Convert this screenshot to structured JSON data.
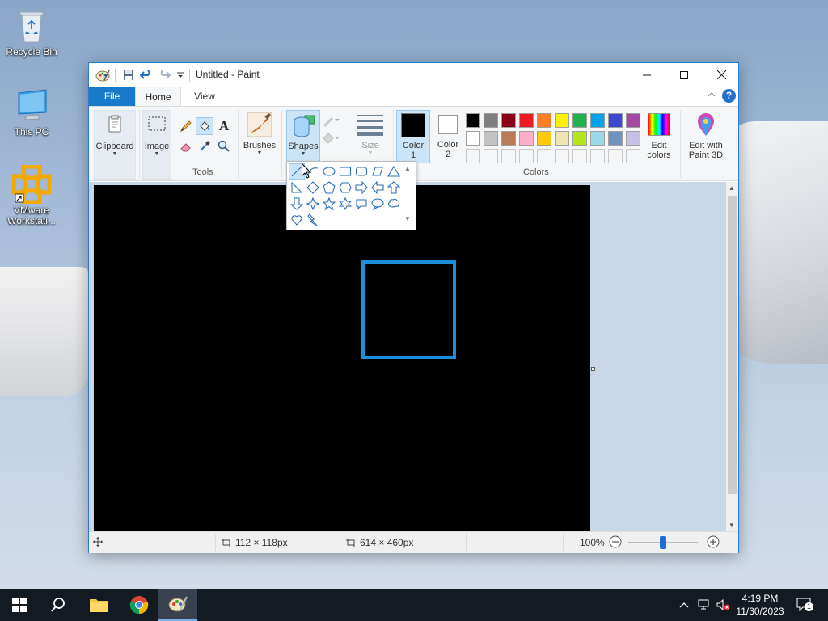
{
  "desktop": {
    "icons": [
      {
        "label": "Recycle Bin"
      },
      {
        "label": "This PC"
      },
      {
        "label": "VMware Workstati..."
      }
    ]
  },
  "window": {
    "title": "Untitled - Paint",
    "tabs": [
      {
        "label": "File"
      },
      {
        "label": "Home"
      },
      {
        "label": "View"
      }
    ]
  },
  "ribbon": {
    "clipboard_label": "Clipboard",
    "image_label": "Image",
    "tools_label": "Tools",
    "brushes_label": "Brushes",
    "shapes_label": "Shapes",
    "size_label": "Size",
    "color1_label_line1": "Color",
    "color1_label_line2": "1",
    "color2_label_line1": "Color",
    "color2_label_line2": "2",
    "colors_group_label": "Colors",
    "edit_colors_line1": "Edit",
    "edit_colors_line2": "colors",
    "paint3d_line1": "Edit with",
    "paint3d_line2": "Paint 3D",
    "color1_value": "#000000",
    "color2_value": "#ffffff",
    "palette_row1": [
      "#000000",
      "#7f7f7f",
      "#880015",
      "#ed1c24",
      "#ff7f27",
      "#fff200",
      "#22b14c",
      "#00a2e8",
      "#3f48cc",
      "#a349a4"
    ],
    "palette_row2": [
      "#ffffff",
      "#c3c3c3",
      "#b97a57",
      "#ffaec9",
      "#ffc90e",
      "#efe4b0",
      "#b5e61d",
      "#99d9ea",
      "#7092be",
      "#c8bfe7"
    ]
  },
  "canvas": {
    "background": "#000000",
    "shape_color": "#1c8fd8"
  },
  "statusbar": {
    "selection_size": "112 × 118px",
    "canvas_size": "614 × 460px",
    "zoom": "100%",
    "zoom_level_percent": 100
  },
  "taskbar": {
    "time": "4:19 PM",
    "date": "11/30/2023",
    "notification_count": "1"
  }
}
